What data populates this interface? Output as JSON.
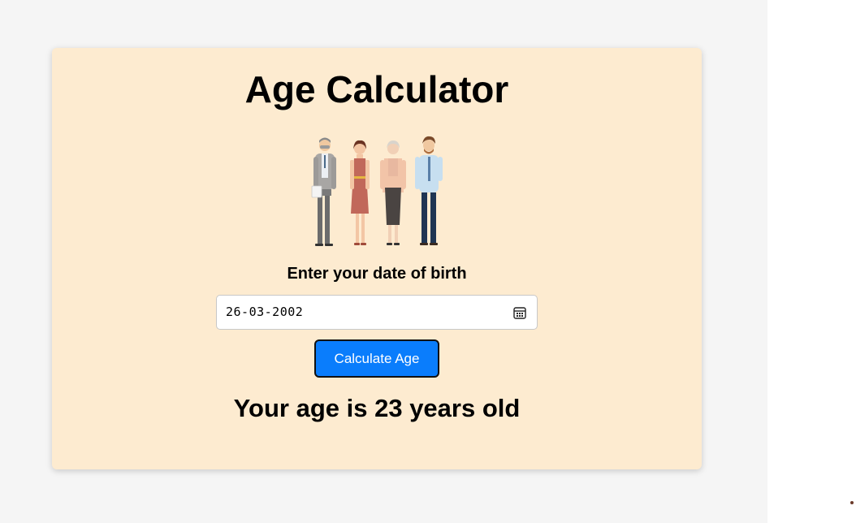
{
  "app": {
    "title": "Age Calculator"
  },
  "illustration": {
    "icon": "people-group-illustration"
  },
  "form": {
    "dob_label": "Enter your date of birth",
    "dob_value": "26-03-2002",
    "calendar_icon": "calendar-icon",
    "button_label": "Calculate Age"
  },
  "result": {
    "text": "Your age is 23 years old"
  },
  "colors": {
    "card_bg": "#fdebd0",
    "page_bg": "#f5f5f5",
    "button_bg": "#0a7dfc"
  }
}
